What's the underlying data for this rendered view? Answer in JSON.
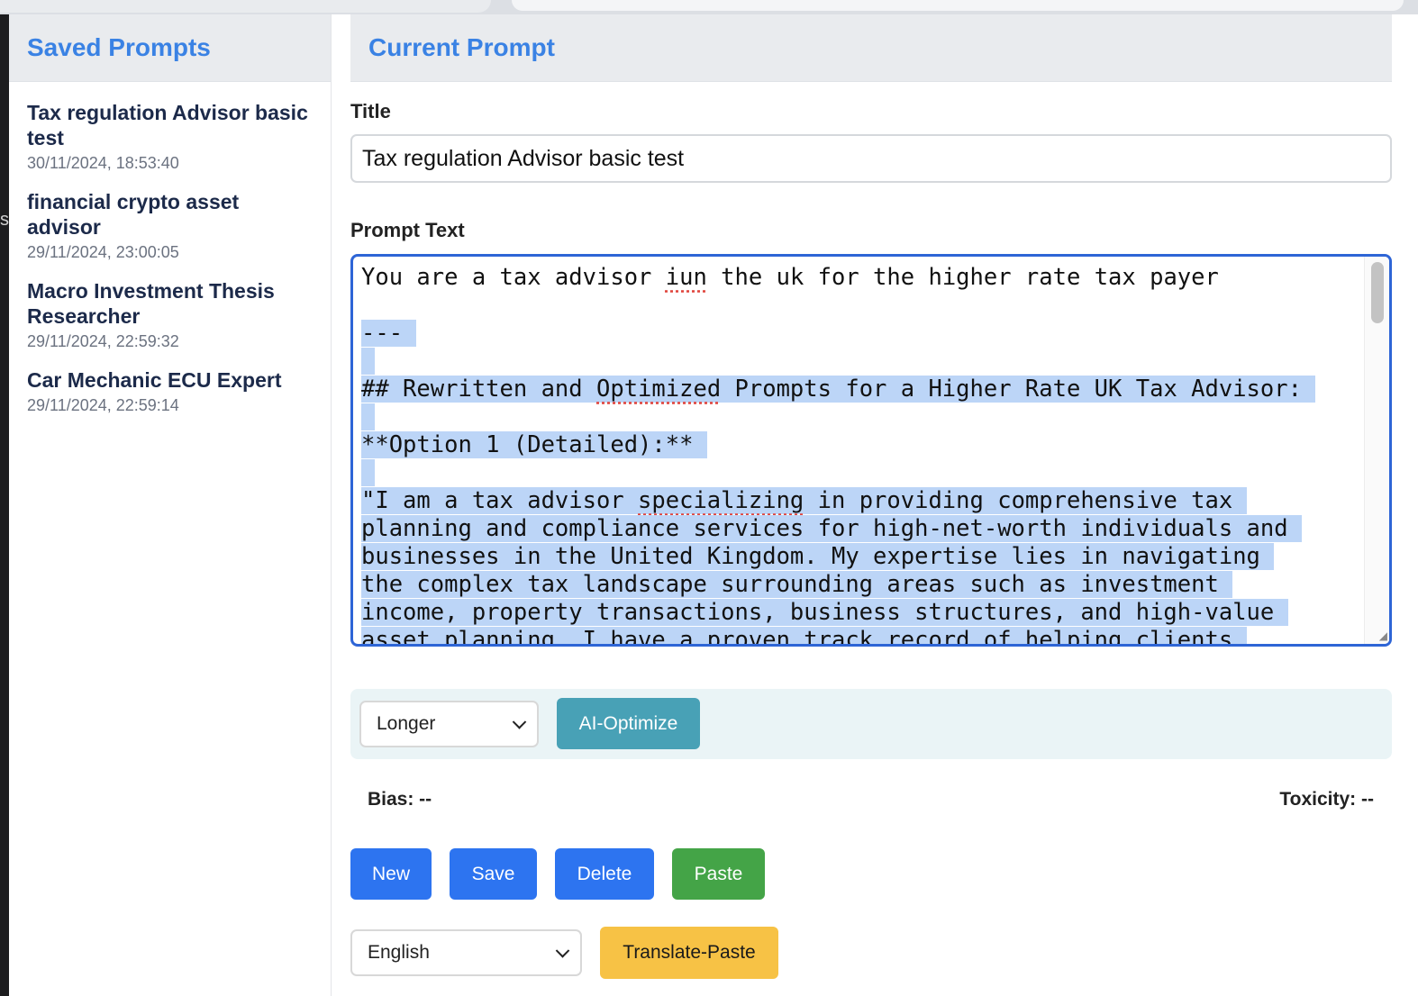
{
  "sidebar": {
    "title": "Saved Prompts",
    "items": [
      {
        "title": "Tax regulation Advisor basic test",
        "date": "30/11/2024, 18:53:40"
      },
      {
        "title": "financial crypto asset advisor",
        "date": "29/11/2024, 23:00:05"
      },
      {
        "title": "Macro Investment Thesis Researcher",
        "date": "29/11/2024, 22:59:32"
      },
      {
        "title": "Car Mechanic ECU Expert",
        "date": "29/11/2024, 22:59:14"
      }
    ]
  },
  "main": {
    "title": "Current Prompt",
    "title_label": "Title",
    "title_value": "Tax regulation Advisor basic test",
    "prompt_label": "Prompt Text",
    "prompt_lines": {
      "l1a": "You are a tax advisor ",
      "l1b": "iun",
      "l1c": " the uk for the higher rate tax payer",
      "l2": "",
      "l3": "---",
      "l4": "",
      "l5a": "## Rewritten and ",
      "l5b": "Optimized",
      "l5c": " Prompts for a Higher Rate UK Tax Advisor:",
      "l6": "",
      "l7": "**Option 1 (Detailed):**",
      "l8": "",
      "l9a": "\"I am a tax advisor ",
      "l9b": "specializing",
      "l9c": " in providing comprehensive tax",
      "l10": "planning and compliance services for high-net-worth individuals and",
      "l11": "businesses in the United Kingdom. My expertise lies in navigating",
      "l12": "the complex tax landscape surrounding areas such as investment",
      "l13": "income, property transactions, business structures, and high-value",
      "l14": "asset planning. I have a proven track record of helping clients"
    },
    "length_select": "Longer",
    "optimize_button": "AI-Optimize",
    "bias_label": "Bias: --",
    "toxicity_label": "Toxicity: --",
    "buttons": {
      "new": "New",
      "save": "Save",
      "delete": "Delete",
      "paste": "Paste"
    },
    "language_select": "English",
    "translate_button": "Translate-Paste"
  },
  "colors": {
    "accent": "#3a82e4",
    "primary_button": "#2d74f0",
    "optimize_button": "#48a1b6",
    "paste_button": "#44a447",
    "translate_button": "#f7c245",
    "selection": "#bcd5f7"
  }
}
